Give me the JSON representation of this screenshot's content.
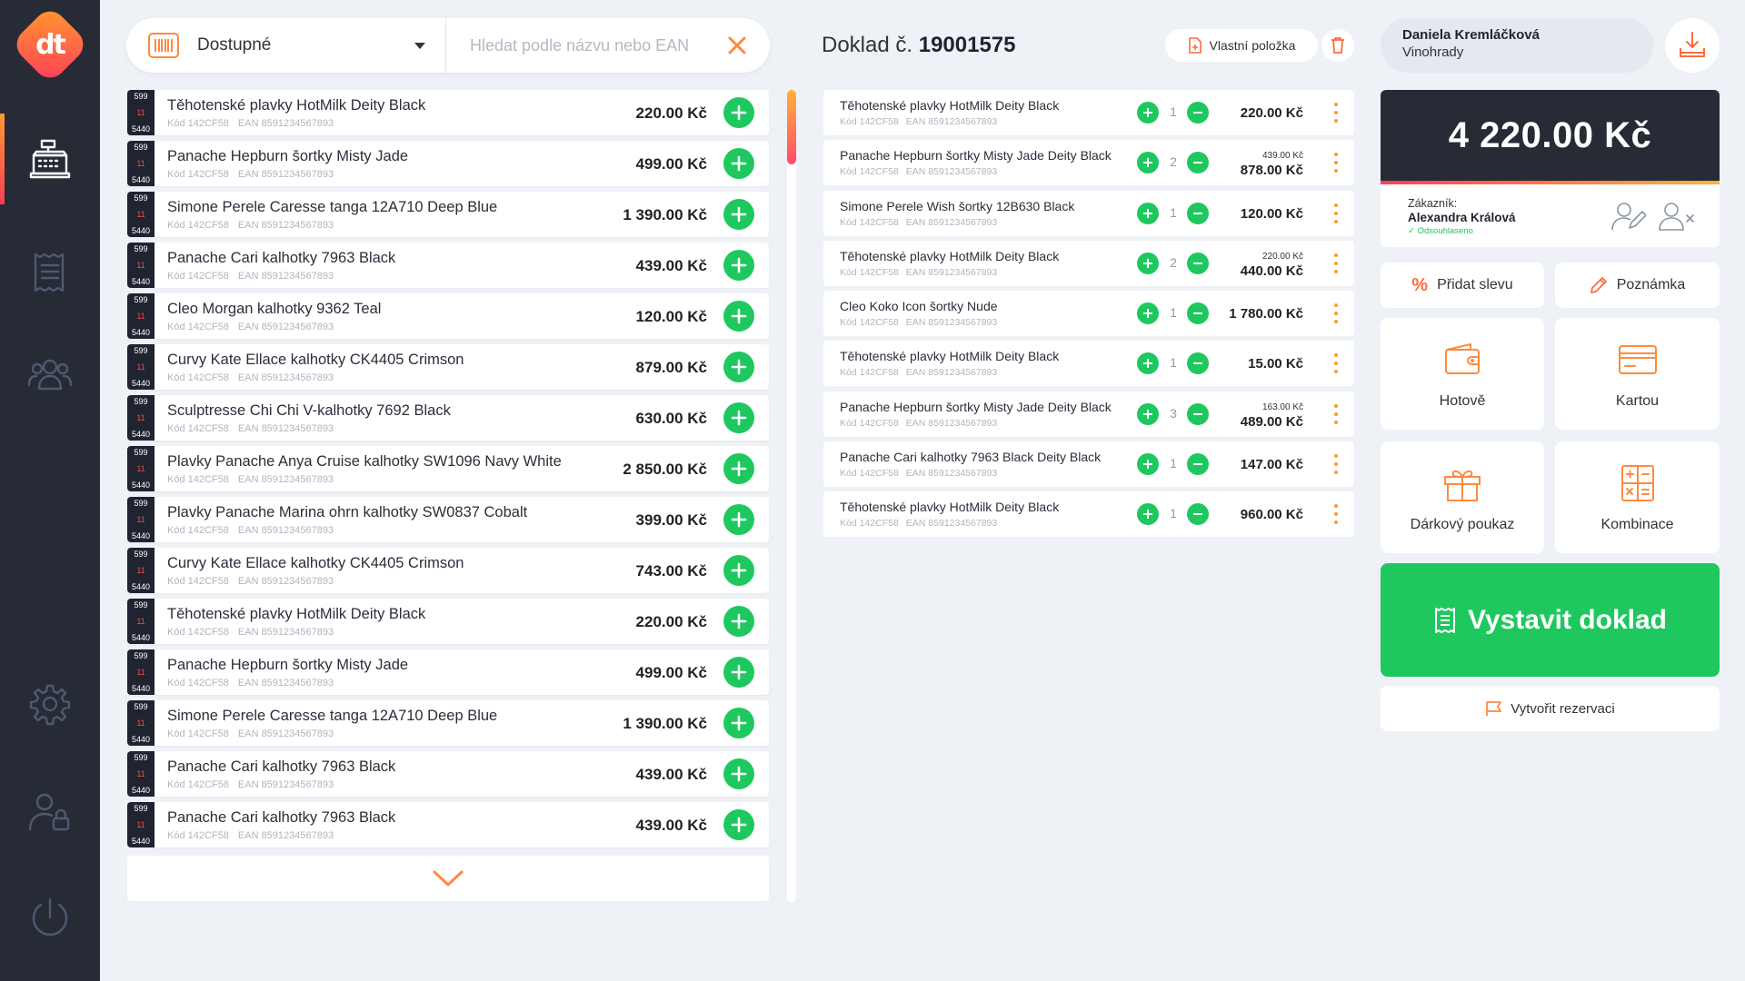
{
  "sidebar": {
    "logo_text": "dt",
    "items": [
      {
        "name": "cash-register-icon",
        "active": true
      },
      {
        "name": "receipt-icon",
        "active": false
      },
      {
        "name": "users-icon",
        "active": false
      },
      {
        "name": "gear-icon",
        "active": false
      },
      {
        "name": "user-lock-icon",
        "active": false
      },
      {
        "name": "power-icon",
        "active": false
      }
    ]
  },
  "search": {
    "filter_value": "Dostupné",
    "placeholder": "Hledat podle názvu nebo EAN",
    "value": ""
  },
  "products": [
    {
      "name": "Těhotenské plavky HotMilk Deity Black",
      "code": "Kód 142CF58",
      "ean": "EAN 8591234567893",
      "price": "220.00 Kč",
      "stock_top": "599",
      "stock_mid": "11",
      "stock_bottom": "5440"
    },
    {
      "name": "Panache Hepburn šortky Misty Jade",
      "code": "Kód 142CF58",
      "ean": "EAN 8591234567893",
      "price": "499.00 Kč",
      "stock_top": "599",
      "stock_mid": "11",
      "stock_bottom": "5440"
    },
    {
      "name": "Simone Perele Caresse tanga 12A710 Deep Blue",
      "code": "Kód 142CF58",
      "ean": "EAN 8591234567893",
      "price": "1 390.00 Kč",
      "stock_top": "599",
      "stock_mid": "11",
      "stock_bottom": "5440"
    },
    {
      "name": "Panache Cari kalhotky 7963 Black",
      "code": "Kód 142CF58",
      "ean": "EAN 8591234567893",
      "price": "439.00 Kč",
      "stock_top": "599",
      "stock_mid": "11",
      "stock_bottom": "5440"
    },
    {
      "name": "Cleo Morgan kalhotky 9362 Teal",
      "code": "Kód 142CF58",
      "ean": "EAN 8591234567893",
      "price": "120.00 Kč",
      "stock_top": "599",
      "stock_mid": "11",
      "stock_bottom": "5440"
    },
    {
      "name": "Curvy Kate Ellace kalhotky CK4405 Crimson",
      "code": "Kód 142CF58",
      "ean": "EAN 8591234567893",
      "price": "879.00 Kč",
      "stock_top": "599",
      "stock_mid": "11",
      "stock_bottom": "5440"
    },
    {
      "name": "Sculptresse Chi Chi V-kalhotky 7692 Black",
      "code": "Kód 142CF58",
      "ean": "EAN 8591234567893",
      "price": "630.00 Kč",
      "stock_top": "599",
      "stock_mid": "11",
      "stock_bottom": "5440"
    },
    {
      "name": "Plavky Panache Anya Cruise kalhotky SW1096 Navy White",
      "code": "Kód 142CF58",
      "ean": "EAN 8591234567893",
      "price": "2 850.00 Kč",
      "stock_top": "599",
      "stock_mid": "11",
      "stock_bottom": "5440"
    },
    {
      "name": "Plavky Panache Marina ohrn kalhotky SW0837 Cobalt",
      "code": "Kód 142CF58",
      "ean": "EAN 8591234567893",
      "price": "399.00 Kč",
      "stock_top": "599",
      "stock_mid": "11",
      "stock_bottom": "5440"
    },
    {
      "name": "Curvy Kate Ellace kalhotky CK4405 Crimson",
      "code": "Kód 142CF58",
      "ean": "EAN 8591234567893",
      "price": "743.00 Kč",
      "stock_top": "599",
      "stock_mid": "11",
      "stock_bottom": "5440"
    },
    {
      "name": "Těhotenské plavky HotMilk Deity Black",
      "code": "Kód 142CF58",
      "ean": "EAN 8591234567893",
      "price": "220.00 Kč",
      "stock_top": "599",
      "stock_mid": "11",
      "stock_bottom": "5440"
    },
    {
      "name": "Panache Hepburn šortky Misty Jade",
      "code": "Kód 142CF58",
      "ean": "EAN 8591234567893",
      "price": "499.00 Kč",
      "stock_top": "599",
      "stock_mid": "11",
      "stock_bottom": "5440"
    },
    {
      "name": "Simone Perele Caresse tanga 12A710 Deep Blue",
      "code": "Kód 142CF58",
      "ean": "EAN 8591234567893",
      "price": "1 390.00 Kč",
      "stock_top": "599",
      "stock_mid": "11",
      "stock_bottom": "5440"
    },
    {
      "name": "Panache Cari kalhotky 7963 Black",
      "code": "Kód 142CF58",
      "ean": "EAN 8591234567893",
      "price": "439.00 Kč",
      "stock_top": "599",
      "stock_mid": "11",
      "stock_bottom": "5440"
    },
    {
      "name": "Panache Cari kalhotky 7963 Black",
      "code": "Kód 142CF58",
      "ean": "EAN 8591234567893",
      "price": "439.00 Kč",
      "stock_top": "599",
      "stock_mid": "11",
      "stock_bottom": "5440"
    }
  ],
  "receipt": {
    "title_prefix": "Doklad č.",
    "number": "19001575",
    "own_item_label": "Vlastní položka",
    "items": [
      {
        "name": "Těhotenské plavky HotMilk Deity Black",
        "code": "Kód 142CF58",
        "ean": "EAN 8591234567893",
        "qty": "1",
        "unit": "",
        "total": "220.00 Kč"
      },
      {
        "name": "Panache Hepburn šortky Misty Jade Deity Black",
        "code": "Kód 142CF58",
        "ean": "EAN 8591234567893",
        "qty": "2",
        "unit": "439.00 Kč",
        "total": "878.00 Kč"
      },
      {
        "name": "Simone Perele Wish šortky 12B630 Black",
        "code": "Kód 142CF58",
        "ean": "EAN 8591234567893",
        "qty": "1",
        "unit": "",
        "total": "120.00 Kč"
      },
      {
        "name": "Těhotenské plavky HotMilk Deity Black",
        "code": "Kód 142CF58",
        "ean": "EAN 8591234567893",
        "qty": "2",
        "unit": "220.00 Kč",
        "total": "440.00 Kč"
      },
      {
        "name": "Cleo Koko Icon šortky Nude",
        "code": "Kód 142CF58",
        "ean": "EAN 8591234567893",
        "qty": "1",
        "unit": "",
        "total": "1 780.00 Kč"
      },
      {
        "name": "Těhotenské plavky HotMilk Deity Black",
        "code": "Kód 142CF58",
        "ean": "EAN 8591234567893",
        "qty": "1",
        "unit": "",
        "total": "15.00 Kč"
      },
      {
        "name": "Panache Hepburn šortky Misty Jade Deity Black",
        "code": "Kód 142CF58",
        "ean": "EAN 8591234567893",
        "qty": "3",
        "unit": "163.00 Kč",
        "total": "489.00 Kč"
      },
      {
        "name": "Panache Cari kalhotky 7963 Black Deity Black",
        "code": "Kód 142CF58",
        "ean": "EAN 8591234567893",
        "qty": "1",
        "unit": "",
        "total": "147.00 Kč"
      },
      {
        "name": "Těhotenské plavky HotMilk Deity Black",
        "code": "Kód 142CF58",
        "ean": "EAN 8591234567893",
        "qty": "1",
        "unit": "",
        "total": "960.00 Kč"
      }
    ]
  },
  "user": {
    "name": "Daniela Kremláčková",
    "store": "Vinohrady"
  },
  "checkout": {
    "total": "4 220.00 Kč",
    "customer_label": "Zákazník:",
    "customer_name": "Alexandra Králová",
    "customer_status": "Odsouhlaseno",
    "discount_label": "Přidat slevu",
    "note_label": "Poznámka",
    "cash_label": "Hotově",
    "card_label": "Kartou",
    "voucher_label": "Dárkový poukaz",
    "combo_label": "Kombinace",
    "issue_label": "Vystavit doklad",
    "reserve_label": "Vytvořit rezervaci"
  },
  "colors": {
    "accent_green": "#1ec85f",
    "accent_orange": "#ff8a3d",
    "sidebar": "#262b36",
    "background": "#eef1f6"
  }
}
